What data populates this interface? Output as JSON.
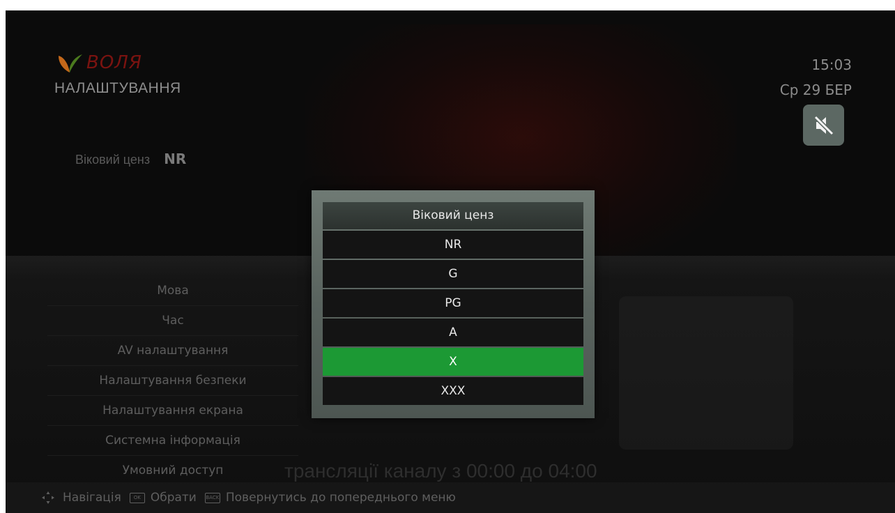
{
  "header": {
    "brand": "ВОЛЯ",
    "section_title": "НАЛАШТУВАННЯ",
    "clock": "15:03",
    "date": "Ср 29 БЕР",
    "mute_icon": "speaker-muted-icon"
  },
  "age_rating": {
    "label": "Віковий ценз",
    "value": "NR"
  },
  "menu": {
    "items": [
      {
        "label": "Мова"
      },
      {
        "label": "Час"
      },
      {
        "label": "AV налаштування"
      },
      {
        "label": "Налаштування безпеки"
      },
      {
        "label": "Налаштування екрана"
      },
      {
        "label": "Системна інформація"
      },
      {
        "label": "Умовний доступ"
      }
    ]
  },
  "modal": {
    "title": "Віковий ценз",
    "options": [
      "NR",
      "G",
      "PG",
      "A",
      "X",
      "XXX"
    ],
    "selected": "X"
  },
  "background_text": "трансляції каналу з 00:00 до 04:00",
  "footer": {
    "navigation": "Навігація",
    "ok_key": "OK",
    "select": "Обрати",
    "back_key": "BACK",
    "back": "Повернутись до попереднього меню"
  },
  "colors": {
    "selection": "#1c9934",
    "modal_frame": "#5f6a65",
    "brand": "#7a1310"
  }
}
